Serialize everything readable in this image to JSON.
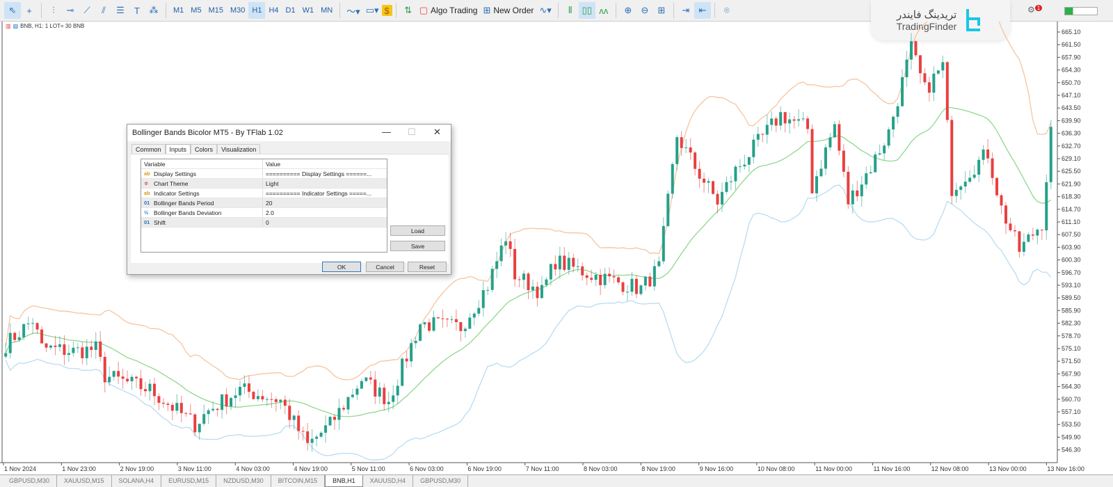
{
  "toolbar": {
    "tools": [
      "cursor-icon",
      "crosshair-icon",
      "vertical-line-icon",
      "horizontal-line-icon",
      "trendline-icon",
      "channel-icon",
      "fibonacci-icon",
      "text-icon",
      "shapes-icon"
    ],
    "timeframes": [
      "M1",
      "M5",
      "M15",
      "M30",
      "H1",
      "H4",
      "D1",
      "W1",
      "MN"
    ],
    "active_timeframe": "H1",
    "algo_trading": "Algo Trading",
    "new_order": "New Order",
    "notifications": "1"
  },
  "logo": {
    "fa": "تریدینگ فایندر",
    "en": "TradingFinder"
  },
  "chart_info": "BNB, H1:  1 LOT= 30 BNB",
  "dialog": {
    "title": "Bollinger Bands Bicolor MT5 - By TFlab 1.02",
    "tabs": [
      "Common",
      "Inputs",
      "Colors",
      "Visualization"
    ],
    "active_tab": "Inputs",
    "headers": [
      "Variable",
      "Value"
    ],
    "rows": [
      {
        "icon": "ab",
        "variable": "Display Settings",
        "value": "========== Display Settings ======..."
      },
      {
        "icon": "enum",
        "variable": "Chart Theme",
        "value": "Light"
      },
      {
        "icon": "ab",
        "variable": "Indicator Settings",
        "value": "========== Indicator Settings =====..."
      },
      {
        "icon": "01",
        "variable": "Bollinger Bands Period",
        "value": "20"
      },
      {
        "icon": "½",
        "variable": "Bollinger Bands Deviation",
        "value": "2.0"
      },
      {
        "icon": "01",
        "variable": "Shift",
        "value": "0"
      }
    ],
    "load": "Load",
    "save": "Save",
    "ok": "OK",
    "cancel": "Cancel",
    "reset": "Reset"
  },
  "chart_data": {
    "type": "candlestick",
    "symbol": "BNB",
    "timeframe": "H1",
    "colors": {
      "up": "#26a08a",
      "down": "#e84040",
      "upper": "#f6c4a0",
      "middle": "#8fd88f",
      "lower": "#b8dcf2"
    },
    "ylim": [
      544.5,
      666.9
    ],
    "y_ticks": [
      "665.10",
      "661.50",
      "657.90",
      "654.30",
      "650.70",
      "647.10",
      "643.50",
      "639.90",
      "636.30",
      "632.70",
      "629.10",
      "625.50",
      "621.90",
      "618.30",
      "614.70",
      "611.10",
      "607.50",
      "603.90",
      "600.30",
      "596.70",
      "593.10",
      "589.50",
      "585.90",
      "582.30",
      "578.70",
      "575.10",
      "571.50",
      "567.90",
      "564.30",
      "560.70",
      "557.10",
      "553.50",
      "549.90",
      "546.30"
    ],
    "x_ticks": [
      "1 Nov 2024",
      "1 Nov 23:00",
      "2 Nov 19:00",
      "3 Nov 11:00",
      "4 Nov 03:00",
      "4 Nov 19:00",
      "5 Nov 11:00",
      "6 Nov 03:00",
      "6 Nov 19:00",
      "7 Nov 11:00",
      "8 Nov 03:00",
      "8 Nov 19:00",
      "9 Nov 16:00",
      "10 Nov 08:00",
      "11 Nov 00:00",
      "11 Nov 16:00",
      "12 Nov 08:00",
      "13 Nov 00:00",
      "13 Nov 16:00"
    ],
    "candle_count": 233,
    "close_waypoints": [
      [
        0,
        576.3
      ],
      [
        6,
        583.2
      ],
      [
        8,
        575.3
      ],
      [
        15,
        574.3
      ],
      [
        20,
        575
      ],
      [
        22,
        567.4
      ],
      [
        32,
        563.4
      ],
      [
        42,
        553.5
      ],
      [
        45,
        557.5
      ],
      [
        52,
        563.4
      ],
      [
        61,
        560.4
      ],
      [
        67,
        547.6
      ],
      [
        72,
        553.5
      ],
      [
        79,
        566.4
      ],
      [
        85,
        560.4
      ],
      [
        92,
        582.2
      ],
      [
        101,
        581.2
      ],
      [
        107,
        593.1
      ],
      [
        111,
        606.9
      ],
      [
        113,
        596.1
      ],
      [
        119,
        591.1
      ],
      [
        122,
        600
      ],
      [
        130,
        596.1
      ],
      [
        141,
        592.1
      ],
      [
        145,
        598.1
      ],
      [
        149,
        635.6
      ],
      [
        153,
        626.7
      ],
      [
        158,
        616.8
      ],
      [
        162,
        625.7
      ],
      [
        172,
        641.6
      ],
      [
        178,
        637.6
      ],
      [
        179,
        620.8
      ],
      [
        184,
        638.6
      ],
      [
        187,
        616.8
      ],
      [
        192,
        626.7
      ],
      [
        196,
        636.6
      ],
      [
        201,
        660.4
      ],
      [
        204,
        648.5
      ],
      [
        208,
        655.4
      ],
      [
        210,
        620.8
      ],
      [
        218,
        630.7
      ],
      [
        221,
        614.9
      ],
      [
        225,
        603
      ],
      [
        230,
        610.9
      ],
      [
        232,
        636.6
      ]
    ],
    "bb_period": 20,
    "bb_deviation": 2.0
  },
  "bottom_tabs": [
    "GBPUSD,M30",
    "XAUUSD,M15",
    "SOLANA,H4",
    "EURUSD,M15",
    "NZDUSD,M30",
    "BITCOIN,M15",
    "BNB,H1",
    "XAUUSD,H4",
    "GBPUSD,M30"
  ],
  "active_bottom_tab": "BNB,H1"
}
